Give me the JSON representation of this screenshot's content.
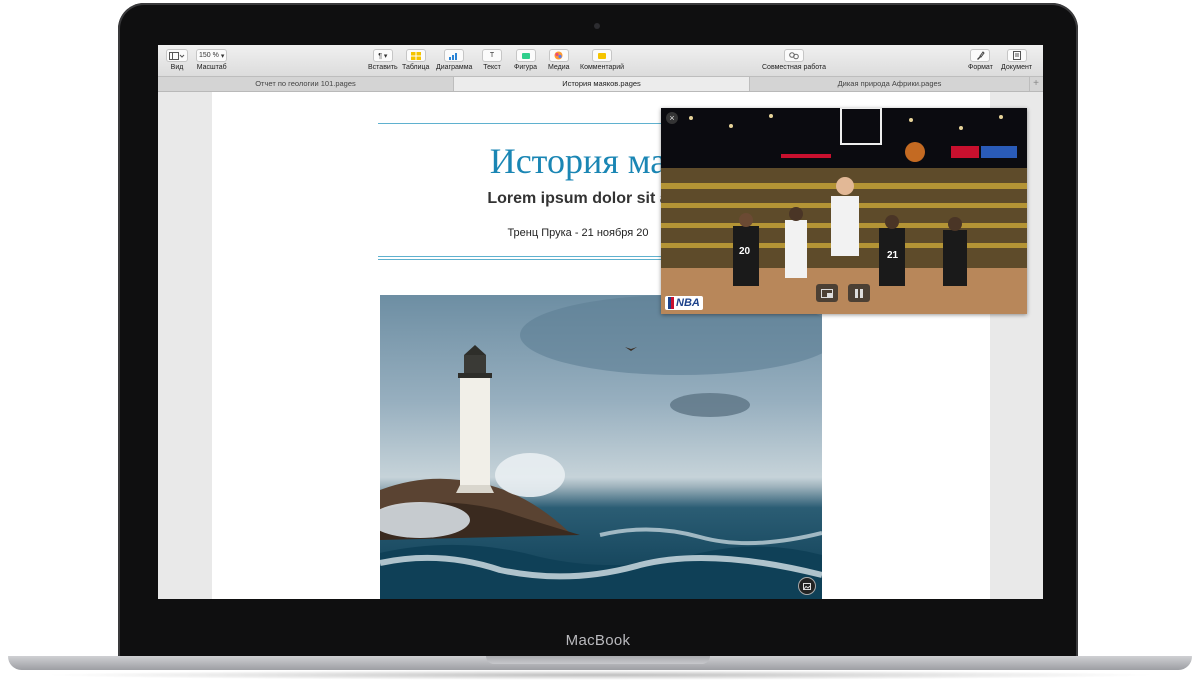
{
  "device": {
    "brand": "MacBook"
  },
  "toolbar": {
    "view_label": "Вид",
    "zoom_value": "150 %",
    "zoom_label": "Масштаб",
    "insert_label": "Вставить",
    "table_label": "Таблица",
    "chart_label": "Диаграмма",
    "text_label": "Текст",
    "shape_label": "Фигура",
    "media_label": "Медиа",
    "comment_label": "Комментарий",
    "collab_label": "Совместная работа",
    "format_label": "Формат",
    "document_label": "Документ"
  },
  "tabs": [
    {
      "label": "Отчет по геологии 101.pages"
    },
    {
      "label": "История маяков.pages"
    },
    {
      "label": "Дикая природа Африки.pages"
    }
  ],
  "document": {
    "title": "История ма",
    "subtitle": "Lorem ipsum dolor sit a",
    "author_line": "Тренц Прука - 21 ноября 20"
  },
  "video": {
    "logo": "NBA",
    "jerseys": [
      "20",
      "21"
    ],
    "controls": [
      "close-icon",
      "pip-return-icon",
      "pause-icon"
    ]
  },
  "colors": {
    "accent": "#1a86b4",
    "rule": "#5fb1cf"
  }
}
